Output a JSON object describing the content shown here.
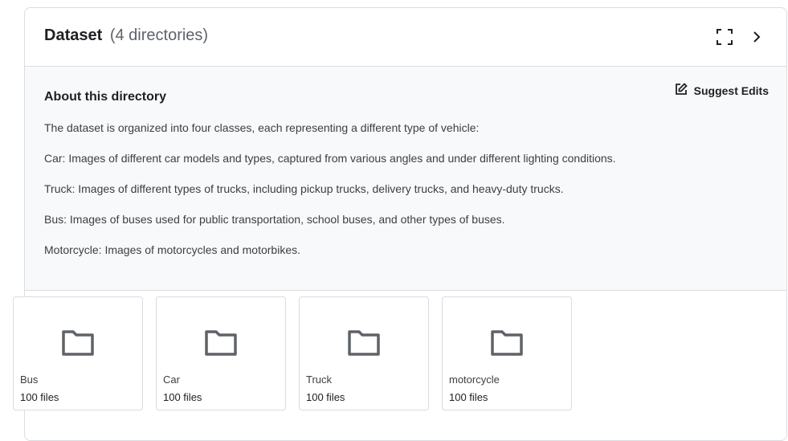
{
  "header": {
    "title": "Dataset",
    "count": "(4 directories)"
  },
  "about": {
    "heading": "About this directory",
    "suggest_label": "Suggest Edits",
    "paragraphs": [
      "The dataset is organized into four classes, each representing a different type of vehicle:",
      "Car: Images of different car models and types, captured from various angles and under different lighting conditions.",
      "Truck: Images of different types of trucks, including pickup trucks, delivery trucks, and heavy-duty trucks.",
      "Bus: Images of buses used for public transportation, school buses, and other types of buses.",
      "Motorcycle: Images of motorcycles and motorbikes."
    ]
  },
  "directories": [
    {
      "name": "Bus",
      "files": "100 files"
    },
    {
      "name": "Car",
      "files": "100 files"
    },
    {
      "name": "Truck",
      "files": "100 files"
    },
    {
      "name": "motorcycle",
      "files": "100 files"
    }
  ],
  "icons": {
    "fullscreen": "fullscreen-icon",
    "chevron": "chevron-right-icon",
    "edit": "edit-icon",
    "folder": "folder-icon"
  }
}
